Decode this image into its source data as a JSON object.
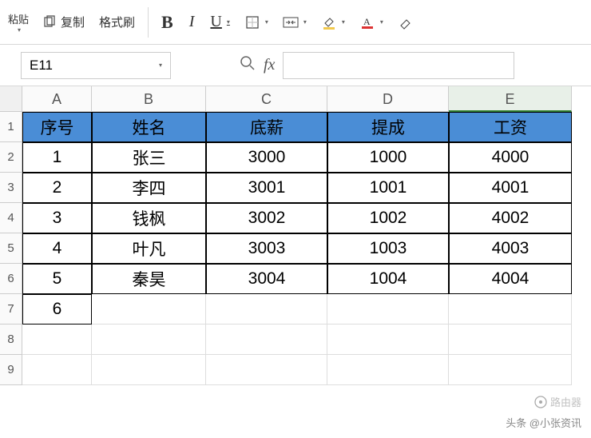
{
  "toolbar": {
    "paste_label": "粘贴",
    "copy_label": "复制",
    "format_painter_label": "格式刷"
  },
  "namebox": {
    "value": "E11"
  },
  "fx": {
    "label": "fx",
    "value": ""
  },
  "columns": [
    "A",
    "B",
    "C",
    "D",
    "E"
  ],
  "row_numbers": [
    "1",
    "2",
    "3",
    "4",
    "5",
    "6",
    "7",
    "8",
    "9"
  ],
  "table": {
    "headers": [
      "序号",
      "姓名",
      "底薪",
      "提成",
      "工资"
    ],
    "rows": [
      [
        "1",
        "张三",
        "3000",
        "1000",
        "4000"
      ],
      [
        "2",
        "李四",
        "3001",
        "1001",
        "4001"
      ],
      [
        "3",
        "钱枫",
        "3002",
        "1002",
        "4002"
      ],
      [
        "4",
        "叶凡",
        "3003",
        "1003",
        "4003"
      ],
      [
        "5",
        "秦昊",
        "3004",
        "1004",
        "4004"
      ],
      [
        "6",
        "",
        "",
        "",
        ""
      ]
    ]
  },
  "watermark2": "路由器",
  "watermark": "头条 @小张资讯"
}
